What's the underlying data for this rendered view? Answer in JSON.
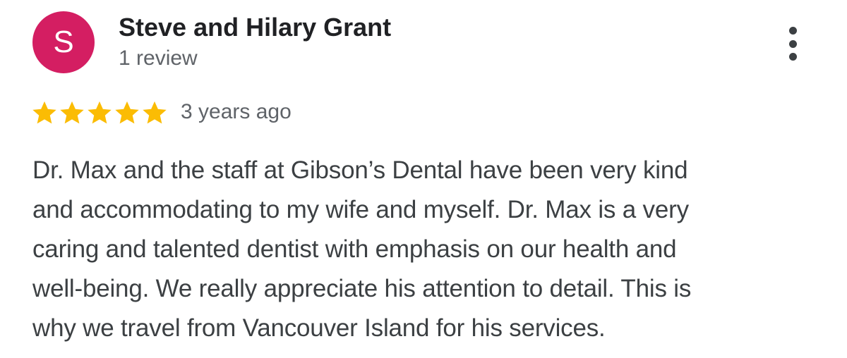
{
  "review": {
    "avatar_initial": "S",
    "avatar_color": "#d41e62",
    "author_name": "Steve and Hilary Grant",
    "author_review_count": "1 review",
    "rating": 5,
    "rating_max": 5,
    "star_color": "#fbbc04",
    "date": "3 years ago",
    "more_icon": "more-vert-icon",
    "text_lines": [
      "Dr. Max and the staff at Gibson’s Dental have been very kind",
      "and accommodating to my wife and myself. Dr. Max is a very",
      "caring and talented dentist with emphasis on our health and",
      "well-being. We really appreciate his attention to detail. This is",
      "why we travel from Vancouver Island for his services."
    ]
  }
}
